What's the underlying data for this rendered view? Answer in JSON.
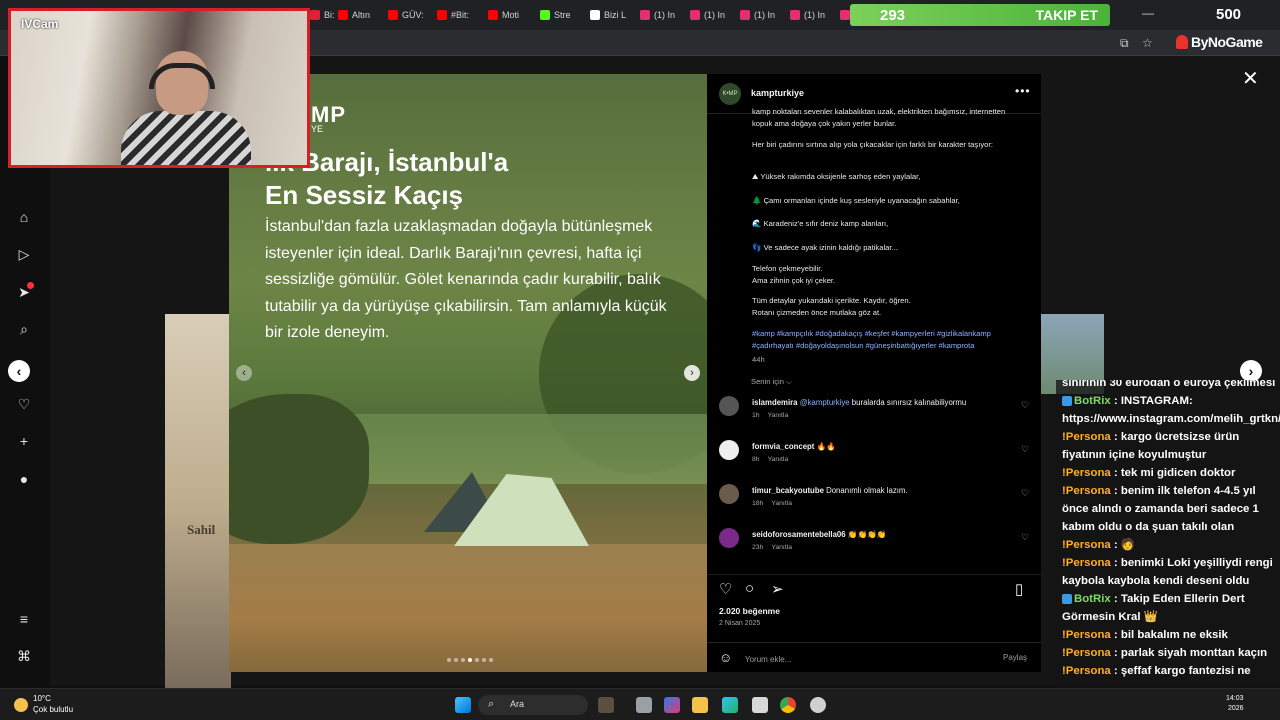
{
  "browser": {
    "tabs": [
      {
        "label": "Bi:",
        "color": "#d23"
      },
      {
        "label": "Altın",
        "color": "#f00"
      },
      {
        "label": "GÜV:",
        "color": "#f00"
      },
      {
        "label": "#Bit:",
        "color": "#f00"
      },
      {
        "label": "Moti",
        "color": "#f00"
      },
      {
        "label": "Stre",
        "color": "#53fc18"
      },
      {
        "label": "Bizi L",
        "color": "#fff"
      },
      {
        "label": "(1) In",
        "color": "#e1306c"
      },
      {
        "label": "(1) In",
        "color": "#e1306c"
      },
      {
        "label": "(1) In",
        "color": "#e1306c"
      },
      {
        "label": "(1) In",
        "color": "#e1306c"
      },
      {
        "label": "(1) In",
        "color": "#e1306c"
      }
    ],
    "new_tab": "+",
    "window_controls": [
      "—",
      "☐"
    ]
  },
  "follow_overlay": {
    "count": "293",
    "label": "TAKIP ET",
    "goal": "500"
  },
  "brand": {
    "name": "ByNoGame"
  },
  "webcam": {
    "label": "IVCam"
  },
  "left_nav": {
    "icons": [
      "home-icon",
      "reels-icon",
      "explore-icon",
      "search-icon",
      "messages-icon",
      "notifications-icon",
      "create-icon",
      "profile-icon",
      "menu-icon",
      "meta-icon"
    ]
  },
  "post": {
    "image": {
      "logo": "MP",
      "logo_sub": "YE",
      "headline": "lık Barajı, İstanbul'a\nEn Sessiz Kaçış",
      "body": "İstanbul'dan fazla uzaklaşmadan doğayla bütünleşmek isteyenler için ideal. Darlık Barajı'nın çevresi, hafta içi sessizliğe gömülür. Gölet kenarında çadır kurabilir, balık tutabilir ya da yürüyüşe çıkabilirsin. Tam anlamıyla küçük bir izole deneyim.",
      "dots": 7,
      "active_dot": 3
    },
    "header": {
      "username": "kampturkiye",
      "avatar_text": "K•MP",
      "more": "•••"
    },
    "caption": {
      "intro": "kamp noktaları sevenler kalabalıktan uzak, elektrikten bağımsız, internetten kopuk ama doğaya çok yakın yerler bunlar.",
      "p1": "Her biri çadırını sırtına alıp yola çıkacaklar için farklı bir karakter taşıyor:",
      "list": [
        "⛰ Yüksek rakımda oksijenle sarhoş eden yaylalar,",
        "🌲 Çamı ormanları içinde kuş sesleriyle uyanacağın sabahlar,",
        "🌊 Karadeniz'e sıfır deniz kamp alanları,",
        "👣 Ve sadece ayak izinin kaldığı patikalar..."
      ],
      "p3": "Telefon çekmeyebilir.\nAma zihnin çok iyi çeker.",
      "p4": "Tüm detaylar yukarıdaki içerikte. Kaydır, öğren.\nRotanı çizmeden önce mutlaka göz at.",
      "hashtags": "#kamp #kampçılık #doğadakaçış #keşfet #kampyerleri #gizlikalankamp #çadırhayatı #doğayoldaşınolsun #güneşinbattığıyerler #kamprota",
      "age": "44h"
    },
    "filter": "Senin için ⌵",
    "comments": [
      {
        "user": "islamdemira",
        "mention": "@kampturkiye",
        "text": " buralarda sınırsız kalınabiliyormu",
        "time": "1h",
        "reply": "Yanıtla",
        "avatar_color": "#555"
      },
      {
        "user": "formvia_concept",
        "mention": "",
        "text": " 🔥🔥",
        "time": "8h",
        "reply": "Yanıtla",
        "avatar_color": "#eee"
      },
      {
        "user": "timur_bcakyoutube",
        "mention": "",
        "text": " Donanımlı olmak lazım.",
        "time": "18h",
        "reply": "Yanıtla",
        "avatar_color": "#6b5b4a"
      },
      {
        "user": "seidoforosamentebella06",
        "mention": "",
        "text": " 👏👏👏👏",
        "time": "23h",
        "reply": "Yanıtla",
        "avatar_color": "#7a2a8a"
      }
    ],
    "likes": "2.020 beğenme",
    "date": "2 Nisan 2025",
    "comment_placeholder": "Yorum ekle...",
    "share_label": "Paylaş"
  },
  "left_thumb_label": "Sahil",
  "chat": [
    {
      "user": "",
      "text": "sınırının 30 eurodan o euroya çekilmesi",
      "bot": false,
      "partial": true
    },
    {
      "user": "BotRix",
      "text": "INSTAGRAM: https://www.instagram.com/melih_grtkn/",
      "bot": true
    },
    {
      "user": "!Persona",
      "text": "kargo ücretsizse ürün fiyatının içine koyulmuştur",
      "bot": false
    },
    {
      "user": "!Persona",
      "text": "tek mi gidicen doktor",
      "bot": false
    },
    {
      "user": "!Persona",
      "text": "benim ilk telefon 4-4.5 yıl önce alındı o zamanda beri sadece 1 kabım oldu o da şuan takılı olan",
      "bot": false
    },
    {
      "user": "!Persona",
      "text": "🧑",
      "bot": false
    },
    {
      "user": "!Persona",
      "text": "benimki Loki yeşilliydi rengi kaybola kaybola kendi deseni oldu",
      "bot": false
    },
    {
      "user": "BotRix",
      "text": "Takip Eden Ellerin Dert Görmesin Kral 👑",
      "bot": true
    },
    {
      "user": "!Persona",
      "text": "bil bakalım ne eksik",
      "bot": false
    },
    {
      "user": "!Persona",
      "text": "parlak siyah monttan kaçın",
      "bot": false
    },
    {
      "user": "!Persona",
      "text": "şeffaf kargo fantezisi ne",
      "bot": false
    }
  ],
  "taskbar": {
    "weather_temp": "10°C",
    "weather_desc": "Çok bulutlu",
    "search": "Ara",
    "time": "14:03",
    "date": "2026"
  }
}
